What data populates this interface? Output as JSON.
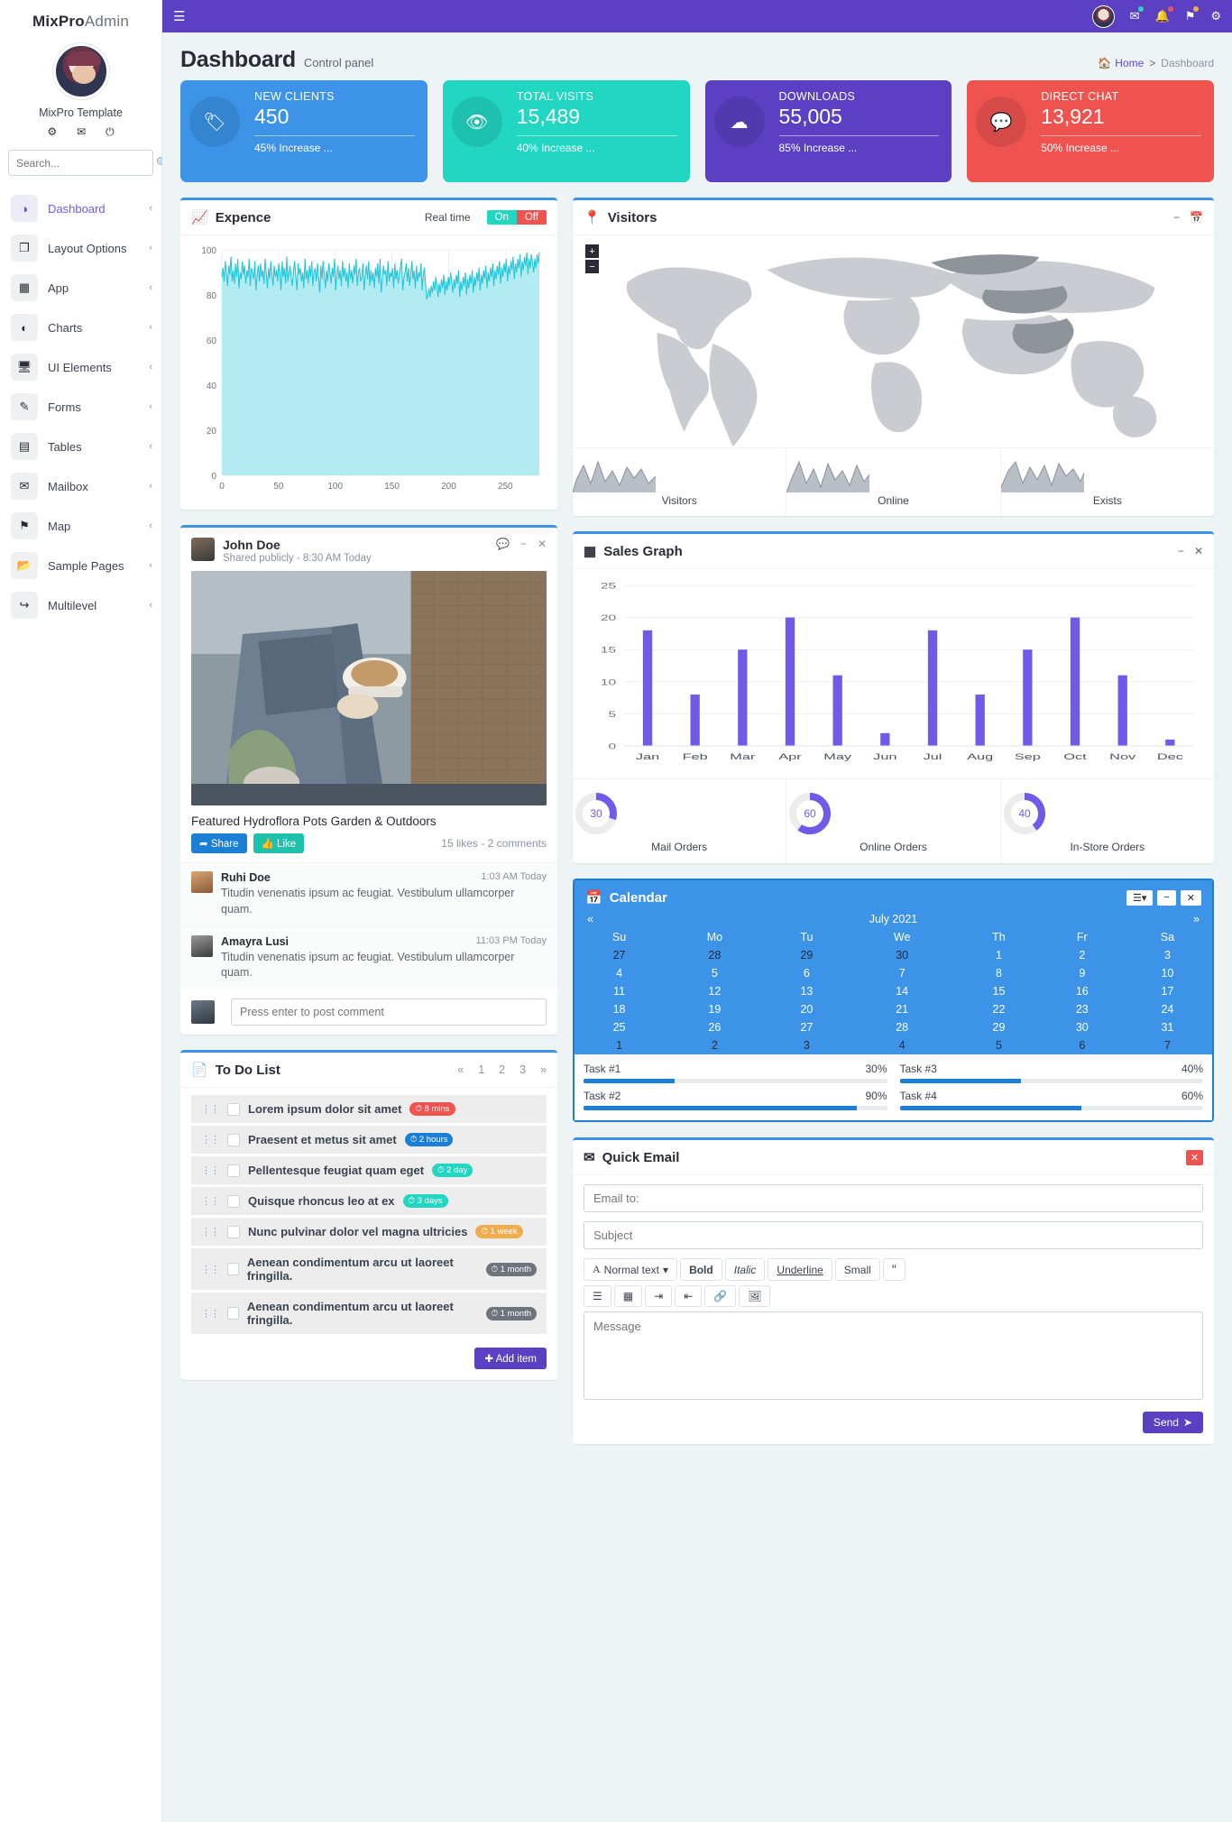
{
  "sidebar": {
    "brand_bold": "MixPro",
    "brand_light": "Admin",
    "template_name": "MixPro Template",
    "icons": [
      "gear-icon",
      "envelope-icon",
      "power-icon"
    ],
    "search_placeholder": "Search...",
    "items": [
      {
        "label": "Dashboard",
        "icon": "dashboard-icon",
        "caret": "‹",
        "active": true
      },
      {
        "label": "Layout Options",
        "icon": "layers-icon",
        "caret": "‹"
      },
      {
        "label": "App",
        "icon": "grid-icon",
        "caret": "‹"
      },
      {
        "label": "Charts",
        "icon": "pie-icon",
        "caret": "‹"
      },
      {
        "label": "UI Elements",
        "icon": "laptop-icon",
        "caret": "‹"
      },
      {
        "label": "Forms",
        "icon": "edit-icon",
        "caret": "‹"
      },
      {
        "label": "Tables",
        "icon": "table-icon",
        "caret": "‹"
      },
      {
        "label": "Mailbox",
        "icon": "mail-icon",
        "caret": "‹"
      },
      {
        "label": "Map",
        "icon": "flag-icon",
        "caret": "‹"
      },
      {
        "label": "Sample Pages",
        "icon": "folder-icon",
        "caret": "‹"
      },
      {
        "label": "Multilevel",
        "icon": "share-icon",
        "caret": "‹"
      }
    ]
  },
  "topbar": {
    "menu_icon": "hamburger-icon",
    "icons": [
      "envelope-icon",
      "bell-icon",
      "flag-icon",
      "gear-icon"
    ]
  },
  "header": {
    "title": "Dashboard",
    "subtitle": "Control panel",
    "breadcrumb_home": "Home",
    "breadcrumb_sep": ">",
    "breadcrumb_current": "Dashboard"
  },
  "infoboxes": [
    {
      "title": "NEW CLIENTS",
      "value": "450",
      "footer": "45% Increase ...",
      "icon": "tag-icon",
      "color": "#3c93e8"
    },
    {
      "title": "TOTAL VISITS",
      "value": "15,489",
      "footer": "40% Increase ...",
      "icon": "eye-icon",
      "color": "#21d7c2"
    },
    {
      "title": "DOWNLOADS",
      "value": "55,005",
      "footer": "85% Increase ...",
      "icon": "cloud-download-icon",
      "color": "#5b40c4"
    },
    {
      "title": "DIRECT CHAT",
      "value": "13,921",
      "footer": "50% Increase ...",
      "icon": "chat-icon",
      "color": "#ef5350"
    }
  ],
  "expence": {
    "title": "Expence",
    "icon": "chart-line-icon",
    "realtime_label": "Real time",
    "on_label": "On",
    "off_label": "Off"
  },
  "visitors": {
    "title": "Visitors",
    "icon": "map-marker-icon",
    "zoom_in": "+",
    "zoom_out": "−",
    "minimize": "−",
    "calendar_icon": "calendar-icon",
    "sparklines": [
      {
        "label": "Visitors"
      },
      {
        "label": "Online"
      },
      {
        "label": "Exists"
      }
    ]
  },
  "post": {
    "author": "John Doe",
    "meta": "Shared publicly - 8:30 AM Today",
    "tools": [
      "comment-icon",
      "minimize-icon",
      "close-icon"
    ],
    "caption": "Featured Hydroflora Pots Garden & Outdoors",
    "share_label": "Share",
    "like_label": "Like",
    "stats": "15 likes - 2 comments",
    "comment_placeholder": "Press enter to post comment",
    "comments": [
      {
        "name": "Ruhi Doe",
        "time": "1:03 AM Today",
        "text": "Titudin venenatis ipsum ac feugiat. Vestibulum ullamcorper quam."
      },
      {
        "name": "Amayra Lusi",
        "time": "11:03 PM Today",
        "text": "Titudin venenatis ipsum ac feugiat. Vestibulum ullamcorper quam."
      }
    ]
  },
  "todo": {
    "title": "To Do List",
    "icon": "file-icon",
    "pager": [
      "«",
      "1",
      "2",
      "3",
      "»"
    ],
    "add_label": "Add item",
    "items": [
      {
        "text": "Lorem ipsum dolor sit amet",
        "badge": "8 mins",
        "badge_color": "#ef5350"
      },
      {
        "text": "Praesent et metus sit amet",
        "badge": "2 hours",
        "badge_color": "#1c7fd6"
      },
      {
        "text": "Pellentesque feugiat quam eget",
        "badge": "2 day",
        "badge_color": "#21d7c2"
      },
      {
        "text": "Quisque rhoncus leo at ex",
        "badge": "3 days",
        "badge_color": "#21d7c2"
      },
      {
        "text": "Nunc pulvinar dolor vel magna ultricies",
        "badge": "1 week",
        "badge_color": "#f0ad4e"
      },
      {
        "text": "Aenean condimentum arcu ut laoreet fringilla.",
        "badge": "1 month",
        "badge_color": "#6c757d"
      },
      {
        "text": "Aenean condimentum arcu ut laoreet fringilla.",
        "badge": "1 month",
        "badge_color": "#6c757d"
      }
    ]
  },
  "sales": {
    "title": "Sales Graph",
    "icon": "grid-icon",
    "minimize": "−",
    "close": "✕",
    "gauges": [
      {
        "value": "30",
        "label": "Mail Orders",
        "pct": 30
      },
      {
        "value": "60",
        "label": "Online Orders",
        "pct": 60
      },
      {
        "value": "40",
        "label": "In-Store Orders",
        "pct": 40
      }
    ]
  },
  "calendar": {
    "title": "Calendar",
    "icon": "calendar-icon",
    "buttons": [
      "list-icon",
      "minimize-icon",
      "close-icon"
    ],
    "prev": "«",
    "next": "»",
    "month": "July 2021",
    "weekdays": [
      "Su",
      "Mo",
      "Tu",
      "We",
      "Th",
      "Fr",
      "Sa"
    ],
    "weeks": [
      [
        {
          "d": "27",
          "dim": true
        },
        {
          "d": "28",
          "dim": true
        },
        {
          "d": "29",
          "dim": true
        },
        {
          "d": "30",
          "dim": true
        },
        {
          "d": "1"
        },
        {
          "d": "2"
        },
        {
          "d": "3"
        }
      ],
      [
        {
          "d": "4"
        },
        {
          "d": "5"
        },
        {
          "d": "6"
        },
        {
          "d": "7"
        },
        {
          "d": "8"
        },
        {
          "d": "9"
        },
        {
          "d": "10"
        }
      ],
      [
        {
          "d": "11"
        },
        {
          "d": "12"
        },
        {
          "d": "13"
        },
        {
          "d": "14"
        },
        {
          "d": "15"
        },
        {
          "d": "16"
        },
        {
          "d": "17"
        }
      ],
      [
        {
          "d": "18"
        },
        {
          "d": "19"
        },
        {
          "d": "20"
        },
        {
          "d": "21"
        },
        {
          "d": "22"
        },
        {
          "d": "23"
        },
        {
          "d": "24"
        }
      ],
      [
        {
          "d": "25"
        },
        {
          "d": "26"
        },
        {
          "d": "27"
        },
        {
          "d": "28"
        },
        {
          "d": "29"
        },
        {
          "d": "30"
        },
        {
          "d": "31"
        }
      ],
      [
        {
          "d": "1",
          "dim": true
        },
        {
          "d": "2",
          "dim": true
        },
        {
          "d": "3",
          "dim": true
        },
        {
          "d": "4",
          "dim": true
        },
        {
          "d": "5",
          "dim": true
        },
        {
          "d": "6",
          "dim": true
        },
        {
          "d": "7",
          "dim": true
        }
      ]
    ],
    "tasks": [
      {
        "label": "Task #1",
        "pct": "30%",
        "value": 30
      },
      {
        "label": "Task #3",
        "pct": "40%",
        "value": 40
      },
      {
        "label": "Task #2",
        "pct": "90%",
        "value": 90
      },
      {
        "label": "Task #4",
        "pct": "60%",
        "value": 60
      }
    ]
  },
  "quick_email": {
    "title": "Quick Email",
    "icon": "envelope-icon",
    "close": "✕",
    "to_placeholder": "Email to:",
    "subject_placeholder": "Subject",
    "toolbar_row1": [
      {
        "label": "Normal text",
        "icon": "font-icon",
        "caret": "▾"
      },
      {
        "label": "Bold",
        "style": "bold"
      },
      {
        "label": "Italic",
        "style": "italic"
      },
      {
        "label": "Underline",
        "style": "underline"
      },
      {
        "label": "Small",
        "style": "small"
      },
      {
        "label": "“",
        "style": "quote"
      }
    ],
    "toolbar_row2": [
      "list-ul-icon",
      "list-grid-icon",
      "indent-icon",
      "outdent-icon",
      "link-icon",
      "image-icon"
    ],
    "message_placeholder": "Message",
    "send_label": "Send"
  },
  "chart_data": [
    {
      "type": "area",
      "title": "Expence",
      "xlabel": "",
      "ylabel": "",
      "xlim": [
        0,
        280
      ],
      "ylim": [
        0,
        100
      ],
      "xticks": [
        0,
        50,
        100,
        150,
        200,
        250
      ],
      "yticks": [
        0,
        20,
        40,
        60,
        80,
        100
      ],
      "series_name": "Expence",
      "line_color": "#26c6da",
      "fill_color": "#a5e9f0",
      "grid": true,
      "note": "dense noisy timeseries oscillating roughly between 78 and 99",
      "values": [
        88,
        92,
        86,
        95,
        90,
        84,
        93,
        89,
        97,
        86,
        91,
        85,
        94,
        88,
        96,
        83,
        90,
        87,
        95,
        89,
        93,
        85,
        91,
        88,
        96,
        84,
        92,
        90,
        87,
        95,
        82,
        89,
        93,
        86,
        94,
        88,
        91,
        85,
        96,
        90,
        83,
        92,
        87,
        95,
        89,
        84,
        93,
        88,
        91,
        86,
        94,
        90,
        82,
        95,
        88,
        92,
        85,
        97,
        86,
        90,
        93,
        87,
        84,
        91,
        95,
        88,
        82,
        94,
        89,
        92,
        86,
        90,
        83,
        96,
        87,
        91,
        85,
        93,
        88,
        95,
        84,
        90,
        92,
        86,
        94,
        88,
        81,
        93,
        87,
        95,
        89,
        83,
        91,
        86,
        94,
        90,
        85,
        92,
        88,
        96,
        82,
        89,
        93,
        87,
        91,
        84,
        95,
        88,
        92,
        86,
        90,
        83,
        94,
        87,
        91,
        85,
        93,
        89,
        96,
        84,
        90,
        92,
        86,
        88,
        94,
        82,
        89,
        93,
        87,
        95,
        84,
        91,
        86,
        90,
        83,
        92,
        88,
        94,
        85,
        96,
        81,
        87,
        93,
        89,
        91,
        84,
        95,
        86,
        90,
        88,
        92,
        83,
        94,
        87,
        91,
        85,
        89,
        93,
        96,
        82,
        88,
        90,
        94,
        86,
        92,
        84,
        89,
        95,
        87,
        91,
        83,
        93,
        86,
        90,
        88,
        94,
        82,
        89,
        92,
        85,
        78,
        80,
        83,
        79,
        84,
        81,
        86,
        82,
        88,
        84,
        79,
        85,
        81,
        87,
        83,
        89,
        80,
        86,
        82,
        88,
        84,
        90,
        86,
        81,
        87,
        83,
        89,
        85,
        91,
        79,
        86,
        82,
        88,
        84,
        90,
        80,
        87,
        83,
        89,
        85,
        91,
        81,
        88,
        84,
        90,
        86,
        92,
        82,
        89,
        85,
        91,
        87,
        93,
        83,
        90,
        86,
        92,
        88,
        94,
        84,
        91,
        87,
        93,
        89,
        95,
        85,
        92,
        88,
        94,
        90,
        96,
        86,
        93,
        89,
        95,
        91,
        97,
        87,
        94,
        90,
        96,
        92,
        98,
        88,
        95,
        91,
        97,
        93,
        99,
        89,
        96,
        92,
        98,
        94,
        90,
        96,
        92,
        98,
        94,
        99
      ]
    },
    {
      "type": "bar",
      "title": "Sales Graph",
      "categories": [
        "Jan",
        "Feb",
        "Mar",
        "Apr",
        "May",
        "Jun",
        "Jul",
        "Aug",
        "Sep",
        "Oct",
        "Nov",
        "Dec"
      ],
      "values": [
        18,
        8,
        15,
        20,
        11,
        2,
        18,
        8,
        15,
        20,
        11,
        1
      ],
      "ylim": [
        0,
        25
      ],
      "yticks": [
        0,
        5,
        10,
        15,
        20,
        25
      ],
      "bar_color": "#6f5be8",
      "grid": true,
      "xlabel": "",
      "ylabel": ""
    },
    {
      "type": "line",
      "title": "Visitors sparkline",
      "values": [
        3,
        10,
        5,
        14,
        6,
        12,
        4,
        11,
        7,
        13,
        5,
        9,
        3
      ],
      "color": "#9aa1ab"
    },
    {
      "type": "line",
      "title": "Online sparkline",
      "values": [
        5,
        13,
        4,
        11,
        8,
        15,
        3,
        12,
        6,
        14,
        5,
        10,
        4
      ],
      "color": "#9aa1ab"
    },
    {
      "type": "line",
      "title": "Exists sparkline",
      "values": [
        4,
        9,
        12,
        5,
        14,
        7,
        11,
        3,
        13,
        6,
        10,
        5,
        8
      ],
      "color": "#9aa1ab"
    }
  ]
}
